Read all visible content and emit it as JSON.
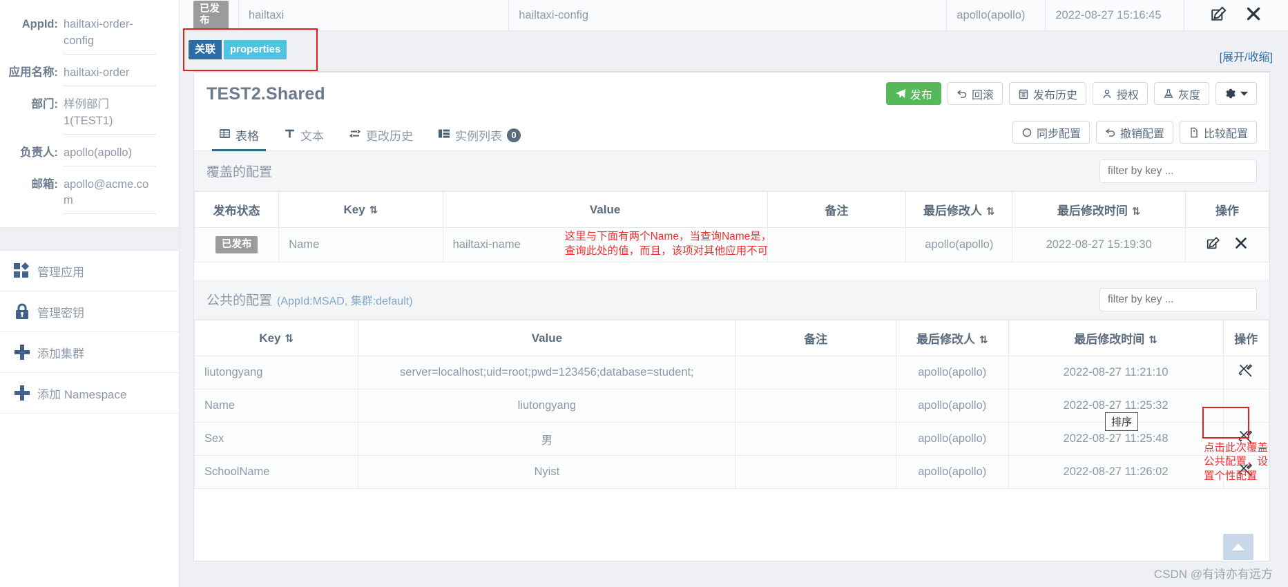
{
  "sidebar": {
    "info": [
      {
        "label": "AppId:",
        "value": "hailtaxi-order-config"
      },
      {
        "label": "应用名称:",
        "value": "hailtaxi-order"
      },
      {
        "label": "部门:",
        "value": "样例部门1(TEST1)"
      },
      {
        "label": "负责人:",
        "value": "apollo(apollo)"
      },
      {
        "label": "邮箱:",
        "value": "apollo@acme.com"
      }
    ],
    "nav": [
      {
        "icon": "grid-apps-icon",
        "label": "管理应用"
      },
      {
        "icon": "lock-icon",
        "label": "管理密钥"
      },
      {
        "icon": "plus-icon",
        "label": "添加集群"
      },
      {
        "icon": "plus-icon",
        "label": "添加 Namespace"
      }
    ]
  },
  "top_strip": {
    "status_badge": "已发布",
    "cluster": "hailtaxi",
    "namespace": "hailtaxi-config",
    "modifier": "apollo(apollo)",
    "modified_time": "2022-08-27 15:16:45",
    "edit_icon": "edit-icon",
    "delete_icon": "close-icon"
  },
  "expand_bar": {
    "link": "[展开/收缩]"
  },
  "namespace_tags": {
    "associated": "关联",
    "format": "properties"
  },
  "panel": {
    "title": "TEST2.Shared",
    "head_buttons": [
      {
        "name": "publish",
        "icon": "send-icon",
        "label": "发布",
        "style": "green"
      },
      {
        "name": "rollback",
        "icon": "undo-icon",
        "label": "回滚",
        "style": "plain"
      },
      {
        "name": "publish-history",
        "icon": "history-icon",
        "label": "发布历史",
        "style": "plain"
      },
      {
        "name": "authorize",
        "icon": "user-icon",
        "label": "授权",
        "style": "plain"
      },
      {
        "name": "grayscale",
        "icon": "flask-icon",
        "label": "灰度",
        "style": "plain"
      },
      {
        "name": "settings",
        "icon": "gear-icon",
        "label": "",
        "style": "plain"
      }
    ],
    "tabs": [
      {
        "icon": "table-icon",
        "label": "表格",
        "active": true,
        "badge": ""
      },
      {
        "icon": "text-icon",
        "label": "文本",
        "active": false,
        "badge": ""
      },
      {
        "icon": "changes-icon",
        "label": "更改历史",
        "active": false,
        "badge": ""
      },
      {
        "icon": "instances-icon",
        "label": "实例列表",
        "active": false,
        "badge": "0"
      }
    ],
    "tab_buttons": [
      {
        "name": "sync-config",
        "icon": "refresh-icon",
        "label": "同步配置"
      },
      {
        "name": "revoke-config",
        "icon": "undo-icon",
        "label": "撤销配置"
      },
      {
        "name": "compare-config",
        "icon": "file-icon",
        "label": "比较配置"
      }
    ]
  },
  "override_section": {
    "title": "覆盖的配置",
    "filter_placeholder": "filter by key ...",
    "columns": [
      "发布状态",
      "Key",
      "Value",
      "备注",
      "最后修改人",
      "最后修改时间",
      "操作"
    ],
    "rows": [
      {
        "status": "已发布",
        "key": "Name",
        "value": "hailtaxi-name",
        "comment": "这里与下面有两个Name，当查询Name是，就会\n查询此处的值，而且，该项对其他应用不可见",
        "comment_is_annotation": true,
        "modifier": "apollo(apollo)",
        "modified_time": "2022-08-27 15:19:30",
        "actions": [
          "edit-icon",
          "close-icon"
        ]
      }
    ]
  },
  "public_section": {
    "title": "公共的配置",
    "subtitle": "(AppId:MSAD, 集群:default)",
    "filter_placeholder": "filter by key ...",
    "columns": [
      "Key",
      "Value",
      "备注",
      "最后修改人",
      "最后修改时间",
      "操作"
    ],
    "rows": [
      {
        "key": "liutongyang",
        "value": "server=localhost;uid=root;pwd=123456;database=student;",
        "comment": "",
        "modifier": "apollo(apollo)",
        "modified_time": "2022-08-27 11:21:10",
        "actions": [
          "wrench-icon"
        ]
      },
      {
        "key": "Name",
        "value": "liutongyang",
        "comment": "",
        "modifier": "apollo(apollo)",
        "modified_time": "2022-08-27 11:25:32",
        "actions": [
          "wrench-icon"
        ]
      },
      {
        "key": "Sex",
        "value": "男",
        "comment": "",
        "modifier": "apollo(apollo)",
        "modified_time": "2022-08-27 11:25:48",
        "actions": [
          "wrench-icon"
        ]
      },
      {
        "key": "SchoolName",
        "value": "Nyist",
        "comment": "",
        "modifier": "apollo(apollo)",
        "modified_time": "2022-08-27 11:26:02",
        "actions": [
          "wrench-icon"
        ]
      }
    ]
  },
  "annotations": {
    "sort_tooltip": "排序",
    "wrench_note": "点击此次覆盖公共配置，设置个性配置",
    "override_note_line1": "这里与下面有两个Name，当查询Name是，就会",
    "override_note_line2": "查询此处的值，而且，该项对其他应用不可见"
  },
  "watermark": "CSDN @有诗亦有远方",
  "colors": {
    "accent_blue": "#2e6ca4",
    "tag_cyan": "#4fc3e0",
    "publish_green": "#55b95a",
    "annotation_red": "#f03030",
    "badge_gray": "#9b9b9b",
    "tab_underline": "#2d6c8a"
  }
}
